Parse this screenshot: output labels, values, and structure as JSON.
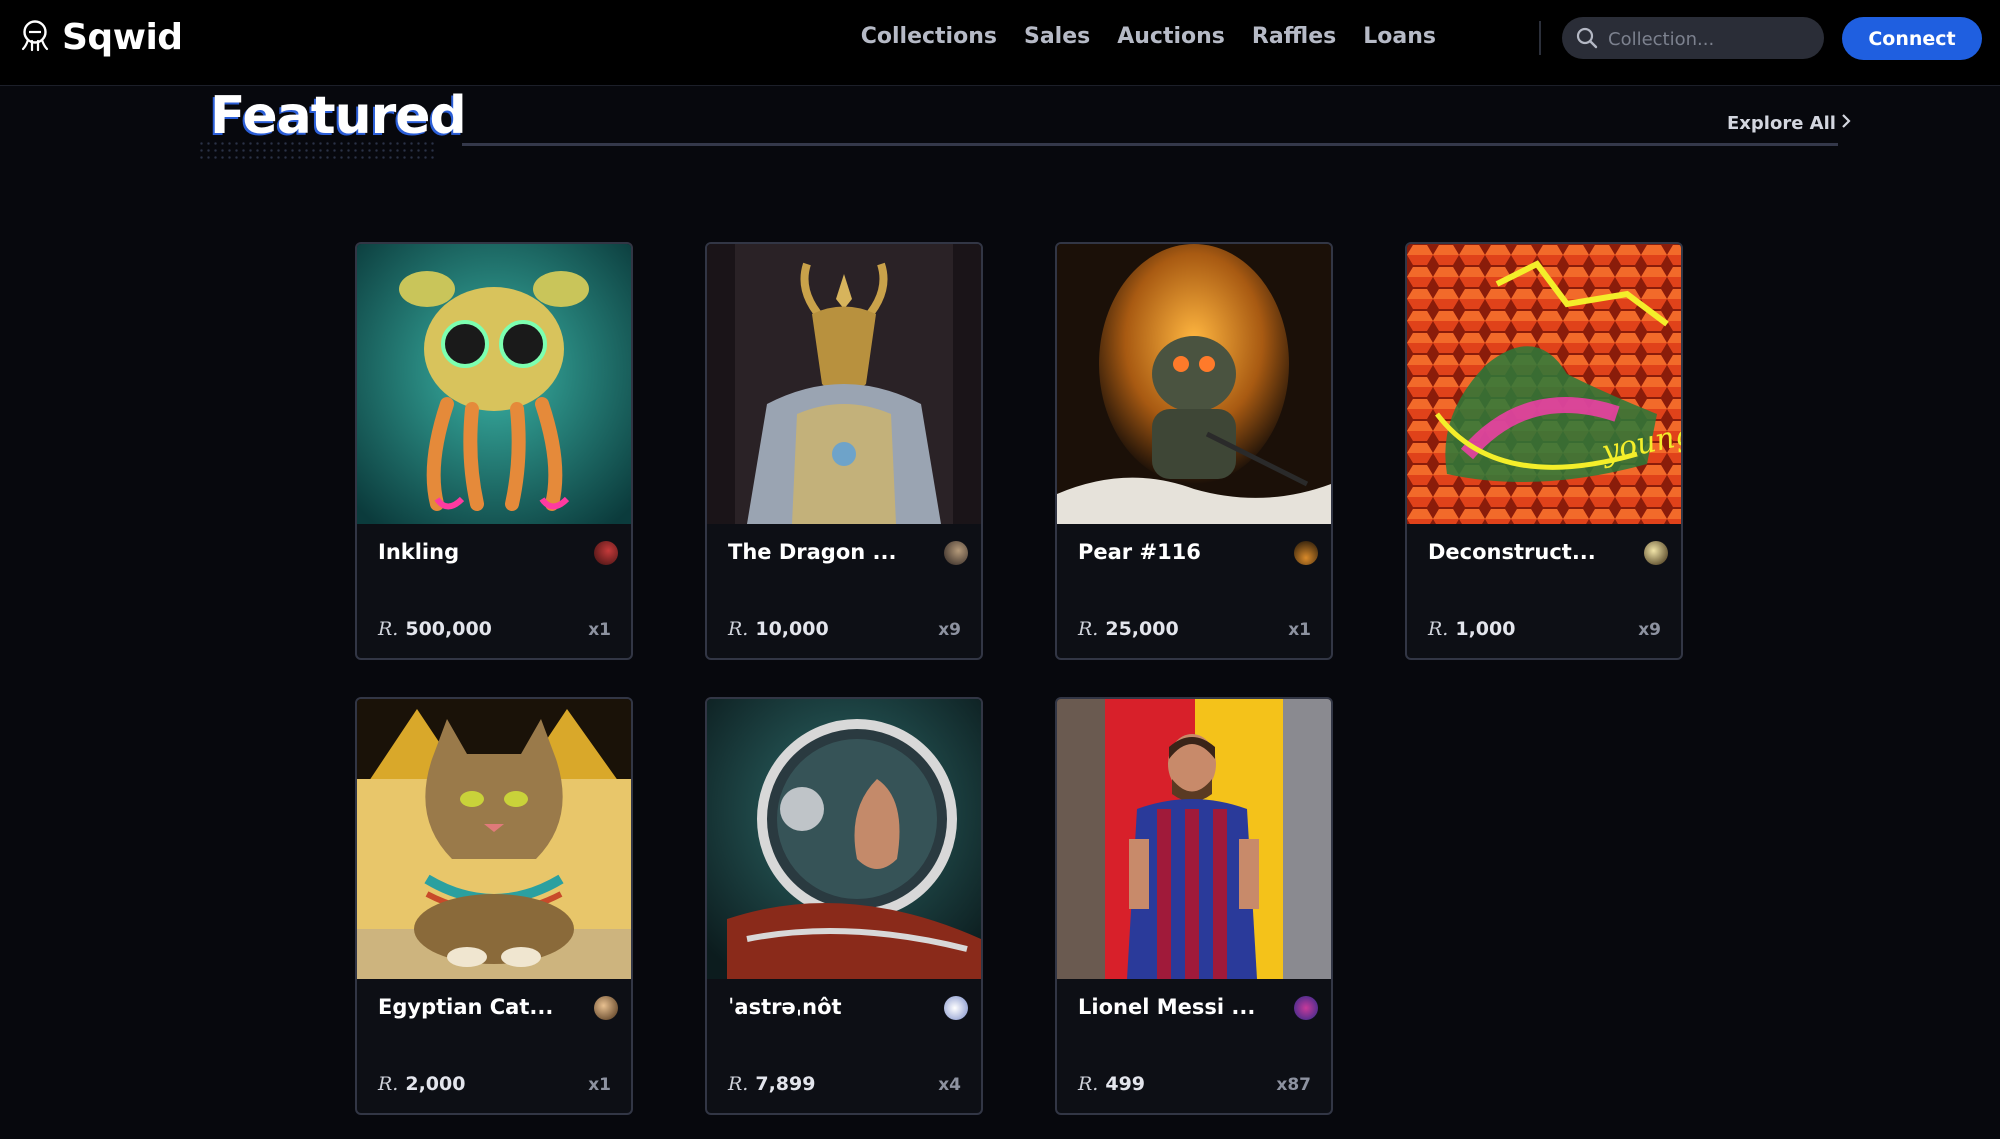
{
  "brand": {
    "name": "Sqwid",
    "logo_icon": "sqwid-logo-icon"
  },
  "nav": {
    "items": [
      "Collections",
      "Sales",
      "Auctions",
      "Raffles",
      "Loans"
    ]
  },
  "search": {
    "placeholder": "Collection..."
  },
  "connect_label": "Connect",
  "section": {
    "title": "Featured",
    "explore_label": "Explore All"
  },
  "colors": {
    "accent": "#1f5fe0",
    "background": "#07080d",
    "navbar": "#000000",
    "card_border": "#323645"
  },
  "cards": [
    {
      "title": "Inkling",
      "price": "500,000",
      "qty": "x1"
    },
    {
      "title": "The Dragon ...",
      "price": "10,000",
      "qty": "x9"
    },
    {
      "title": "Pear #116",
      "price": "25,000",
      "qty": "x1"
    },
    {
      "title": "Deconstruct...",
      "price": "1,000",
      "qty": "x9"
    },
    {
      "title": "Egyptian Cat...",
      "price": "2,000",
      "qty": "x1"
    },
    {
      "title": "ˈastrəˌnôt",
      "price": "7,899",
      "qty": "x4"
    },
    {
      "title": "Lionel Messi ...",
      "price": "499",
      "qty": "x87"
    }
  ],
  "currency_symbol": "R."
}
